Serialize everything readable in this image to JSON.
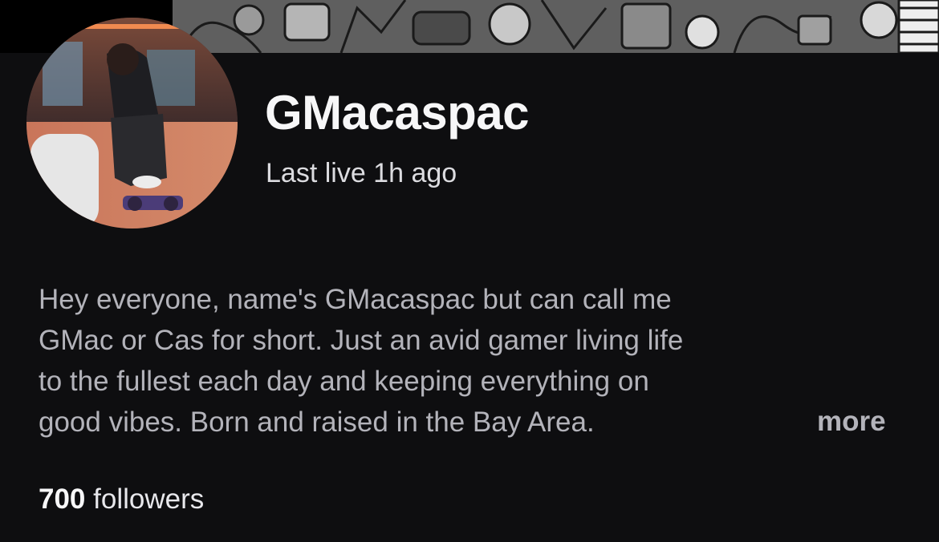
{
  "profile": {
    "name": "GMacaspac",
    "status": "Last live 1h ago",
    "bio_lines": [
      "Hey everyone, name's GMacaspac but can call me",
      "GMac or Cas for short. Just an avid gamer living life",
      "to the fullest each day and keeping everything on",
      "good vibes. Born and raised in the Bay Area."
    ],
    "more_label": "more",
    "followers_count": "700",
    "followers_label": "followers"
  },
  "colors": {
    "background": "#0e0e10",
    "banner": "#6e6e6e",
    "name_text": "#f7f7f8",
    "bio_text": "#b3b3ba"
  },
  "icons": [
    "avatar-photo",
    "banner-art"
  ]
}
